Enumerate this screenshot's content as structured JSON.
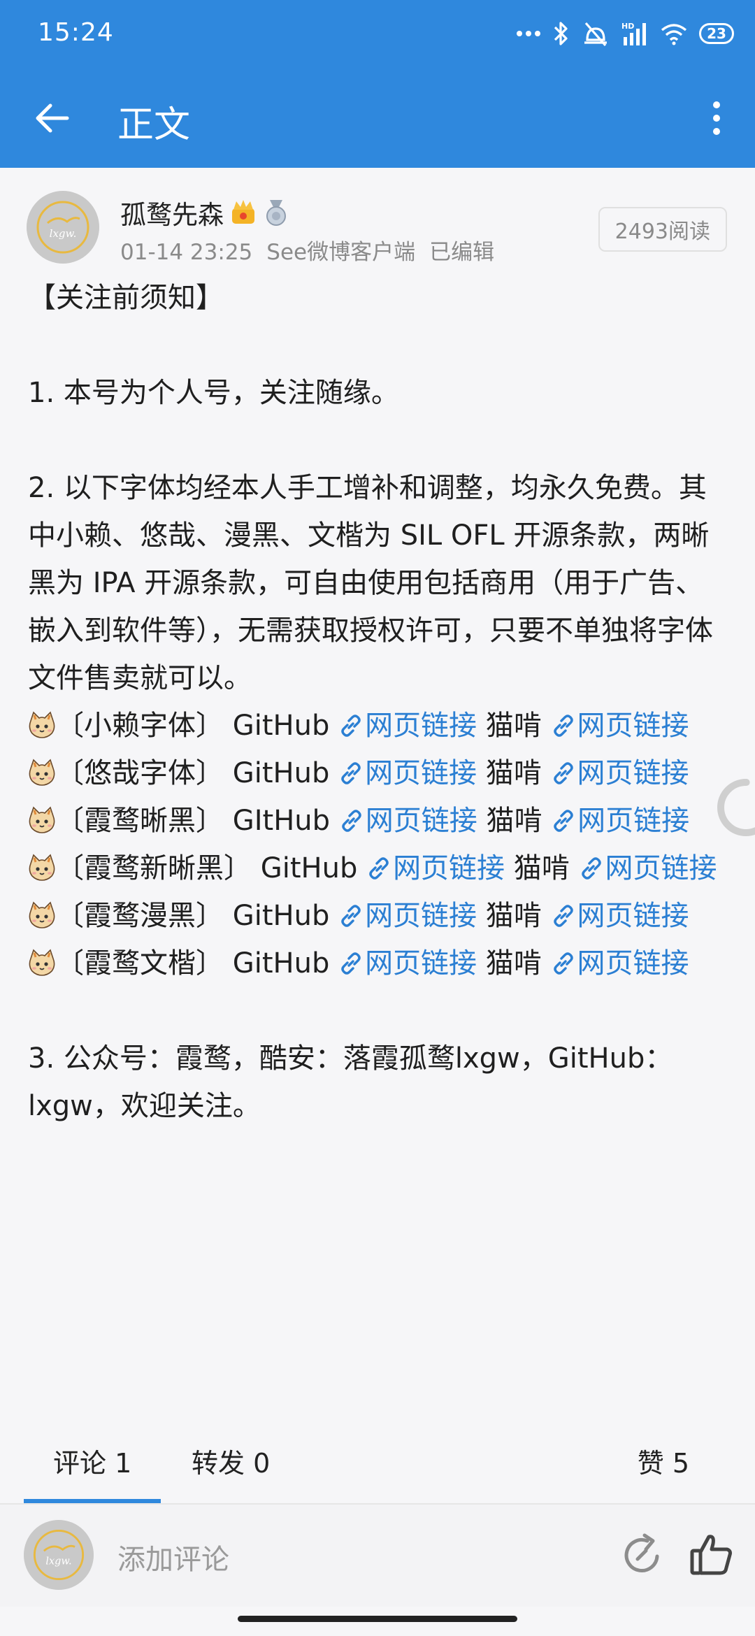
{
  "status_bar": {
    "time": "15:24",
    "battery": "23"
  },
  "app_bar": {
    "title": "正文"
  },
  "author": {
    "name": "孤鹜先森",
    "avatar_text": "lxgw.",
    "timestamp": "01-14 23:25",
    "source": "See微博客户端",
    "edited": "已编辑",
    "read_count": "2493阅读"
  },
  "post": {
    "heading": "【关注前须知】",
    "para1": "1. 本号为个人号，关注随缘。",
    "para2": "2. 以下字体均经本人手工增补和调整，均永久免费。其中小赖、悠哉、漫黑、文楷为 SIL OFL 开源条款，两晰黑为 IPA 开源条款，可自由使用包括商用（用于广告、嵌入到软件等），无需获取授权许可，只要不单独将字体文件售卖就可以。",
    "link_label": "网页链接",
    "github_label": "GitHub",
    "maoshao_label": "猫啃",
    "fonts": [
      {
        "name": "〔小赖字体〕",
        "github": "GitHub"
      },
      {
        "name": "〔悠哉字体〕",
        "github": "GitHub"
      },
      {
        "name": "〔霞鹜晰黑〕",
        "github": "GItHub"
      },
      {
        "name": "〔霞鹜新晰黑〕",
        "github": "GitHub"
      },
      {
        "name": "〔霞鹜漫黑〕",
        "github": "GitHub"
      },
      {
        "name": "〔霞鹜文楷〕",
        "github": "GitHub"
      }
    ],
    "para3": "3. 公众号：霞鹜，酷安：落霞孤鹜lxgw，GitHub：lxgw，欢迎关注。"
  },
  "tabs": {
    "comments": "评论 1",
    "reposts": "转发 0",
    "likes": "赞 5"
  },
  "comment_bar": {
    "placeholder": "添加评论"
  },
  "colors": {
    "primary": "#2f88dd",
    "link": "#2b7fd3",
    "text": "#1f1f1f",
    "muted": "#8a8a8a"
  },
  "icons": {
    "back": "arrow-left-icon",
    "more": "more-vertical-icon",
    "link": "link-icon",
    "cat": "cat-emoji-icon",
    "share": "share-icon",
    "like": "thumbs-up-icon"
  }
}
